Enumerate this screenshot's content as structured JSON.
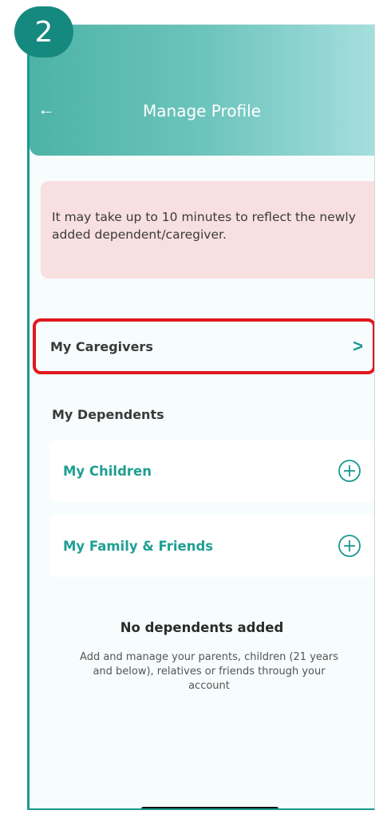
{
  "step_badge": "2",
  "header": {
    "title": "Manage Profile",
    "back_icon": "arrow-left-icon"
  },
  "banner": {
    "text": "It may take up to 10 minutes to reflect the newly added dependent/caregiver."
  },
  "caregivers": {
    "label": "My Caregivers",
    "icon": "chevron-right-icon"
  },
  "dependents": {
    "heading": "My Dependents",
    "items": [
      {
        "label": "My Children",
        "icon": "plus-circle-icon"
      },
      {
        "label": "My Family & Friends",
        "icon": "plus-circle-icon"
      }
    ]
  },
  "empty_state": {
    "title": "No dependents added",
    "description": "Add and manage your parents, children (21 years and below), relatives or friends through your account"
  },
  "colors": {
    "accent": "#1a9a8f",
    "highlight": "#e0191d",
    "banner_bg": "#f8dfe0",
    "badge": "#16897f"
  }
}
